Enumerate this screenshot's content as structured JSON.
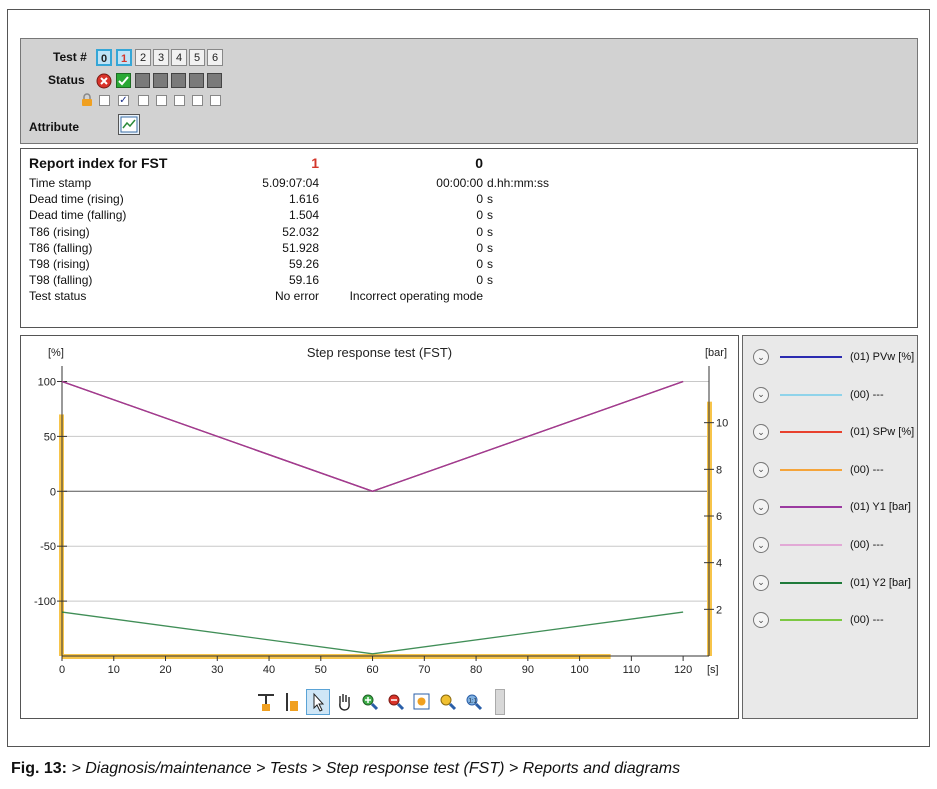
{
  "test_panel": {
    "test_label": "Test #",
    "status_label": "Status",
    "attribute_label": "Attribute",
    "tests": [
      "0",
      "1",
      "2",
      "3",
      "4",
      "5",
      "6"
    ],
    "selected_tests": [
      "0",
      "1"
    ]
  },
  "report": {
    "title": "Report index for FST",
    "col1": "1",
    "col2": "0",
    "rows": [
      {
        "label": "Time stamp",
        "v1": "5.09:07:04",
        "v2": "00:00:00",
        "unit": "d.hh:mm:ss"
      },
      {
        "label": "Dead time (rising)",
        "v1": "1.616",
        "v2": "0",
        "unit": "s"
      },
      {
        "label": "Dead time (falling)",
        "v1": "1.504",
        "v2": "0",
        "unit": "s"
      },
      {
        "label": "T86 (rising)",
        "v1": "52.032",
        "v2": "0",
        "unit": "s"
      },
      {
        "label": "T86 (falling)",
        "v1": "51.928",
        "v2": "0",
        "unit": "s"
      },
      {
        "label": "T98 (rising)",
        "v1": "59.26",
        "v2": "0",
        "unit": "s"
      },
      {
        "label": "T98 (falling)",
        "v1": "59.16",
        "v2": "0",
        "unit": "s"
      },
      {
        "label": "Test status",
        "v1": "No error",
        "v2": "Incorrect operating mode",
        "unit": ""
      }
    ]
  },
  "chart_data": {
    "type": "line",
    "title": "Step response test (FST)",
    "ylabel_left": "[%]",
    "ylabel_right": "[bar]",
    "xlabel": "[s]",
    "xlim": [
      0,
      125
    ],
    "ylim_left": [
      -150,
      105
    ],
    "ylim_right": [
      0,
      12
    ],
    "x_ticks": [
      0,
      10,
      20,
      30,
      40,
      50,
      60,
      70,
      80,
      90,
      100,
      110,
      120
    ],
    "y_ticks_left": [
      100,
      50,
      0,
      -50,
      -100
    ],
    "y_ticks_right": [
      2,
      4,
      6,
      8,
      10
    ],
    "series": [
      {
        "name": "(01) PVw [%]",
        "color": "#2b2bb0",
        "x": [
          0,
          60,
          120
        ],
        "y": [
          100,
          0,
          100
        ]
      },
      {
        "name": "(01) SPw [%]",
        "color": "#e03a2c",
        "x": [
          0,
          60,
          120
        ],
        "y": [
          100,
          0,
          100
        ]
      },
      {
        "name": "(01) Y1 [bar]",
        "color": "#9b3aa0",
        "x": [
          0,
          60,
          120
        ],
        "y": [
          100,
          0,
          100
        ]
      },
      {
        "name": "(01) Y2 [bar]",
        "color": "#1f7a3a",
        "x": [
          0,
          60,
          120
        ],
        "y": [
          -110,
          -148,
          -110
        ]
      }
    ]
  },
  "legend": {
    "items": [
      {
        "label": "(01) PVw [%]",
        "color": "#2b2bb0"
      },
      {
        "label": "(00) ---",
        "color": "#8fd3ea"
      },
      {
        "label": "(01) SPw [%]",
        "color": "#e8412d"
      },
      {
        "label": "(00) ---",
        "color": "#f5a43a"
      },
      {
        "label": "(01) Y1 [bar]",
        "color": "#9b3aa0"
      },
      {
        "label": "(00) ---",
        "color": "#e2a9d6"
      },
      {
        "label": "(01) Y2 [bar]",
        "color": "#1f7a3a"
      },
      {
        "label": "(00) ---",
        "color": "#7cc843"
      }
    ]
  },
  "caption": {
    "prefix": "Fig. 13:",
    "text": " > Diagnosis/maintenance > Tests > Step response test (FST) > Reports and diagrams"
  }
}
